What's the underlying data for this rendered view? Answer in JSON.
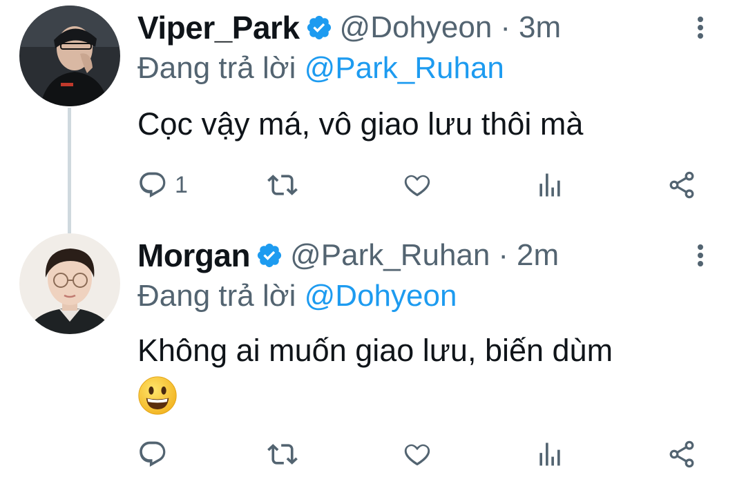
{
  "tweets": [
    {
      "display_name": "Viper_Park",
      "verified": true,
      "handle": "@Dohyeon",
      "separator": "·",
      "time": "3m",
      "reply_prefix": "Đang trả lời",
      "reply_to": "@Park_Ruhan",
      "text": "Cọc vậy má, vô giao lưu thôi mà",
      "reply_count": "1",
      "icons": [
        "reply-icon",
        "retweet-icon",
        "like-icon",
        "stats-icon",
        "share-icon"
      ]
    },
    {
      "display_name": "Morgan",
      "verified": true,
      "handle": "@Park_Ruhan",
      "separator": "·",
      "time": "2m",
      "reply_prefix": "Đang trả lời",
      "reply_to": "@Dohyeon",
      "text": "Không ai muốn giao lưu, biến dùm",
      "emoji": "smiling-face-emoji",
      "icons": [
        "reply-icon",
        "retweet-icon",
        "like-icon",
        "stats-icon",
        "share-icon"
      ]
    }
  ],
  "colors": {
    "accent": "#1d9bf0",
    "text_primary": "#0f1419",
    "text_secondary": "#536471",
    "thread_line": "#cfd9de",
    "verified_badge": "#1d9bf0"
  }
}
